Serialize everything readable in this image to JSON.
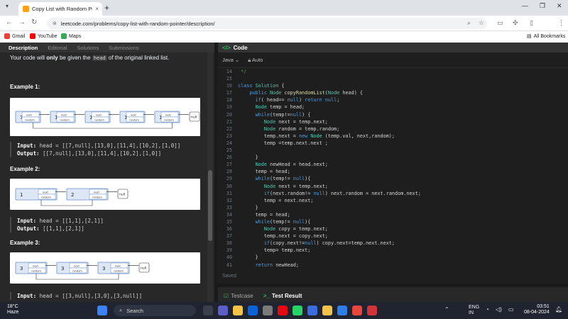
{
  "browser": {
    "tab": {
      "title": "Copy List with Random Pointer",
      "icon": "leetcode-icon",
      "close": "×"
    },
    "new_tab": "+",
    "window_controls": [
      "—",
      "❐",
      "✕"
    ],
    "url": "leetcode.com/problems/copy-list-with-random-pointer/description/",
    "bookmarks": [
      {
        "label": "Gmail",
        "color": "#ea4335"
      },
      {
        "label": "YouTube",
        "color": "#ff0000"
      },
      {
        "label": "Maps",
        "color": "#34a853"
      }
    ],
    "all_bookmarks": "All Bookmarks"
  },
  "left": {
    "tabs": [
      "Description",
      "Editorial",
      "Solutions",
      "Submissions"
    ],
    "intro": {
      "pre": "Your code will ",
      "bold": "only",
      "mid": " be given the ",
      "code": "head",
      "post": " of the original linked list."
    },
    "examples": [
      {
        "heading": "Example 1:",
        "input_label": "Input:",
        "input": "head = [[7,null],[13,0],[11,4],[10,2],[1,0]]",
        "output_label": "Output:",
        "output": "[[7,null],[13,0],[11,4],[10,2],[1,0]]",
        "nodes": [
          "7",
          "13",
          "11",
          "10",
          "1"
        ]
      },
      {
        "heading": "Example 2:",
        "input_label": "Input:",
        "input": "head = [[1,1],[2,1]]",
        "output_label": "Output:",
        "output": "[[1,1],[2,1]]",
        "nodes": [
          "1",
          "2"
        ]
      },
      {
        "heading": "Example 3:",
        "input_label": "Input:",
        "input": "head = [[3,null],[3,0],[3,null]]",
        "nodes": [
          "3",
          "3",
          "3"
        ]
      }
    ],
    "node_labels": {
      "next": "next",
      "random": "random",
      "null": "null"
    }
  },
  "code": {
    "header": "Code",
    "language": "Java",
    "mode": "Auto",
    "saved": "Saved",
    "lines": [
      {
        "n": "14",
        "t": " */"
      },
      {
        "n": "15",
        "t": ""
      },
      {
        "n": "16",
        "t": "class Solution {"
      },
      {
        "n": "17",
        "t": "    public Node copyRandomList(Node head) {"
      },
      {
        "n": "18",
        "t": "      if( head== null) return null;"
      },
      {
        "n": "19",
        "t": "      Node temp = head;"
      },
      {
        "n": "20",
        "t": "      while(temp!=null) {"
      },
      {
        "n": "21",
        "t": "         Node next = temp.next;"
      },
      {
        "n": "22",
        "t": "         Node random = temp.random;"
      },
      {
        "n": "23",
        "t": "         temp.next = new Node (temp.val, next,random);"
      },
      {
        "n": "24",
        "t": "         temp =temp.next.next ;"
      },
      {
        "n": "25",
        "t": ""
      },
      {
        "n": "26",
        "t": "      }"
      },
      {
        "n": "27",
        "t": "      Node newHead = head.next;"
      },
      {
        "n": "28",
        "t": "      temp = head;"
      },
      {
        "n": "29",
        "t": "      while(temp!= null){"
      },
      {
        "n": "30",
        "t": "         Node next = temp.next;"
      },
      {
        "n": "31",
        "t": "         if(next.random!= null) next.random = next.random.next;"
      },
      {
        "n": "32",
        "t": "         temp = next.next;"
      },
      {
        "n": "33",
        "t": "      }"
      },
      {
        "n": "34",
        "t": "      temp = head;"
      },
      {
        "n": "35",
        "t": "      while(temp!= null){"
      },
      {
        "n": "36",
        "t": "         Node copy = temp.next;"
      },
      {
        "n": "37",
        "t": "         temp.next = copy.next;"
      },
      {
        "n": "38",
        "t": "         if(copy.next!=null) copy.next=temp.next.next;"
      },
      {
        "n": "39",
        "t": "         temp= temp.next;"
      },
      {
        "n": "40",
        "t": "      }"
      },
      {
        "n": "41",
        "t": "      return newHead;"
      }
    ]
  },
  "bottom": {
    "testcase": "Testcase",
    "test_result": "Test Result"
  },
  "taskbar": {
    "weather_temp": "18°C",
    "weather_desc": "Haze",
    "search_placeholder": "Search",
    "apps": [
      {
        "name": "task-view-icon",
        "color": "#3a3f4b"
      },
      {
        "name": "teams-icon",
        "color": "#5b5fc7"
      },
      {
        "name": "file-explorer-icon",
        "color": "#f6c344"
      },
      {
        "name": "mail-icon",
        "color": "#0a64d8"
      },
      {
        "name": "settings-icon",
        "color": "#7a7a7a"
      },
      {
        "name": "netflix-icon",
        "color": "#e50914"
      },
      {
        "name": "whatsapp-icon",
        "color": "#25d366"
      },
      {
        "name": "store-icon",
        "color": "#3b6de0"
      },
      {
        "name": "folder-icon",
        "color": "#f3c24d"
      },
      {
        "name": "vscode-icon",
        "color": "#2f7ee6"
      },
      {
        "name": "chrome-icon",
        "color": "#e8453c"
      },
      {
        "name": "photos-icon",
        "color": "#d13438"
      }
    ],
    "lang": "ENG",
    "region": "IN",
    "time": "03:51",
    "date": "08-04-2024"
  }
}
